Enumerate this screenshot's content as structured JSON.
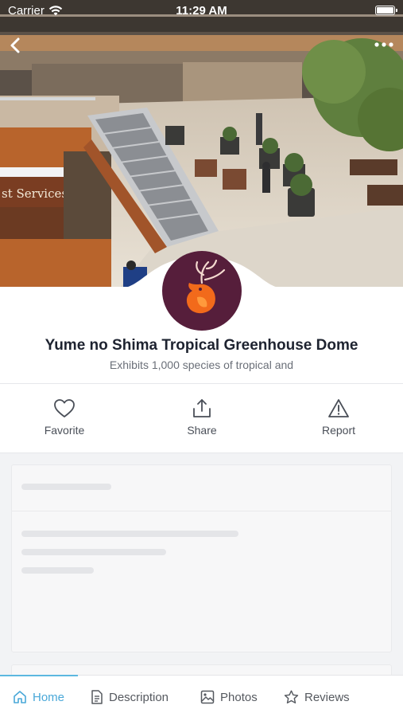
{
  "status_bar": {
    "carrier": "Carrier",
    "time": "11:29 AM"
  },
  "place": {
    "title": "Yume no Shima Tropical Greenhouse Dome",
    "subtitle": "Exhibits 1,000 species of tropical and",
    "hero_sign": "st Services"
  },
  "actions": [
    {
      "label": "Favorite",
      "icon": "heart-icon"
    },
    {
      "label": "Share",
      "icon": "share-icon"
    },
    {
      "label": "Report",
      "icon": "warning-icon"
    }
  ],
  "tabs": [
    {
      "label": "Home",
      "icon": "home-icon",
      "active": true
    },
    {
      "label": "Description",
      "icon": "document-icon",
      "active": false
    },
    {
      "label": "Photos",
      "icon": "image-icon",
      "active": false
    },
    {
      "label": "Reviews",
      "icon": "star-icon",
      "active": false
    }
  ],
  "colors": {
    "accent": "#4aa8d8",
    "avatar_bg": "#561e3b",
    "logo_orange": "#f26a1b"
  }
}
